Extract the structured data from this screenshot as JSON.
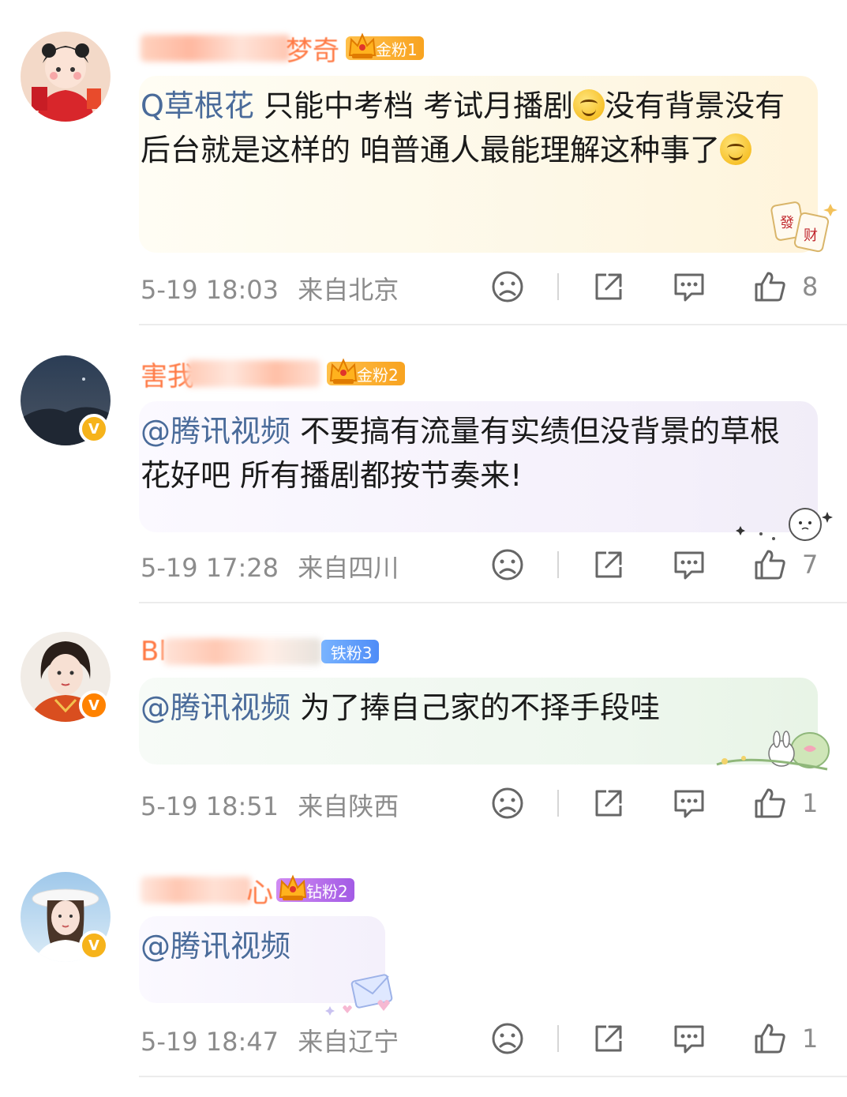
{
  "comments": [
    {
      "name_visible": "梦奇",
      "fan_badge": "金粉1",
      "text_at": "Q草根花",
      "text": " 只能中考档 考试月播剧",
      "text_after_emoji": "没有背景没有后台就是这样的 咱普通人最能理解这种事了",
      "time": "5-19 18:03",
      "location": "来自北京",
      "likes": "8"
    },
    {
      "name_visible": "害我",
      "fan_badge": "金粉2",
      "text_at": "@腾讯视频",
      "text": " 不要搞有流量有实绩但没背景的草根花好吧 所有播剧都按节奏来!",
      "time": "5-19 17:28",
      "location": "来自四川",
      "likes": "7"
    },
    {
      "name_visible": "Bl",
      "fan_badge": "铁粉3",
      "text_at": "@腾讯视频",
      "text": " 为了捧自己家的不择手段哇",
      "time": "5-19 18:51",
      "location": "来自陕西",
      "likes": "1"
    },
    {
      "name_visible": "心",
      "fan_badge": "钻粉2",
      "text_at": "@腾讯视频",
      "text": "",
      "time": "5-19 18:47",
      "location": "来自辽宁",
      "likes": "1"
    }
  ],
  "icons": [
    "sad-face-icon",
    "share-icon",
    "comment-icon",
    "thumbs-up-icon",
    "verified-v-icon",
    "crown-icon",
    "smile-emoji-icon"
  ],
  "colors": {
    "gold_badge": "#f8a320",
    "iron_badge": "#4e8cf7",
    "diamond_badge": "#a35be5",
    "mention": "#4a6b9a",
    "meta": "#8c8c8c"
  }
}
